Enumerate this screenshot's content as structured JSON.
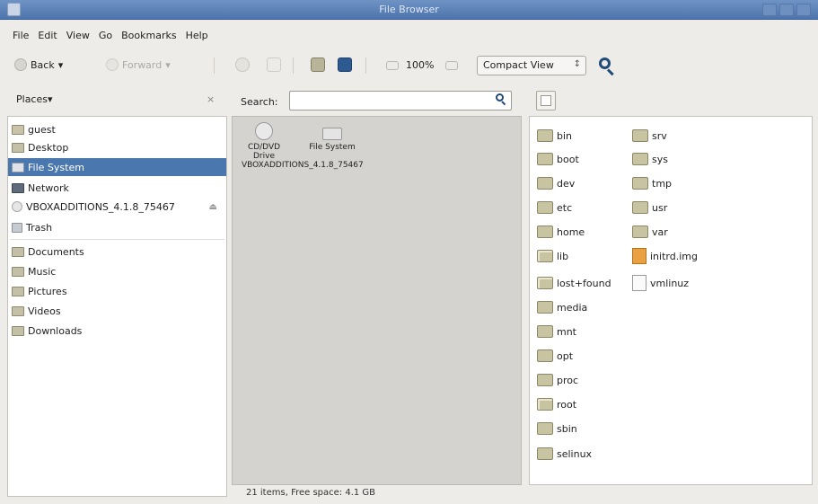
{
  "window": {
    "title": "File Browser"
  },
  "menu": [
    "File",
    "Edit",
    "View",
    "Go",
    "Bookmarks",
    "Help"
  ],
  "toolbar": {
    "back_label": "Back",
    "back_caret": "▾",
    "forward_label": "Forward",
    "forward_caret": "▾",
    "zoom_level": "100%",
    "view_mode": "Compact View",
    "view_caret": "↕"
  },
  "places": {
    "header": "Places",
    "header_caret": "▾",
    "close": "×",
    "items": [
      {
        "label": "guest",
        "icon": "home-folder-icon"
      },
      {
        "label": "Desktop",
        "icon": "desktop-folder-icon"
      },
      {
        "label": "File System",
        "icon": "filesystem-icon",
        "selected": true
      },
      {
        "label": "Network",
        "icon": "network-icon"
      },
      {
        "label": "VBOXADDITIONS_4.1.8_75467",
        "icon": "cd-icon",
        "eject": "⏏"
      },
      {
        "label": "Trash",
        "icon": "trash-icon"
      },
      {
        "label": "Documents",
        "icon": "folder-icon"
      },
      {
        "label": "Music",
        "icon": "folder-icon"
      },
      {
        "label": "Pictures",
        "icon": "folder-icon"
      },
      {
        "label": "Videos",
        "icon": "folder-icon"
      },
      {
        "label": "Downloads",
        "icon": "folder-icon"
      }
    ]
  },
  "search": {
    "label": "Search:",
    "value": ""
  },
  "devices": [
    {
      "label": "CD/DVD Drive VBOXADDITIONS_4.1.8_75467",
      "icon": "cd-drive-icon"
    },
    {
      "label": "File System",
      "icon": "harddisk-icon"
    }
  ],
  "files": {
    "col1": [
      "bin",
      "boot",
      "dev",
      "etc",
      "home",
      "lib",
      "lost+found",
      "media",
      "mnt",
      "opt",
      "proc",
      "root",
      "sbin",
      "selinux"
    ],
    "col2": [
      "srv",
      "sys",
      "tmp",
      "usr",
      "var",
      "initrd.img",
      "vmlinuz"
    ]
  },
  "status": "21 items, Free space: 4.1 GB"
}
